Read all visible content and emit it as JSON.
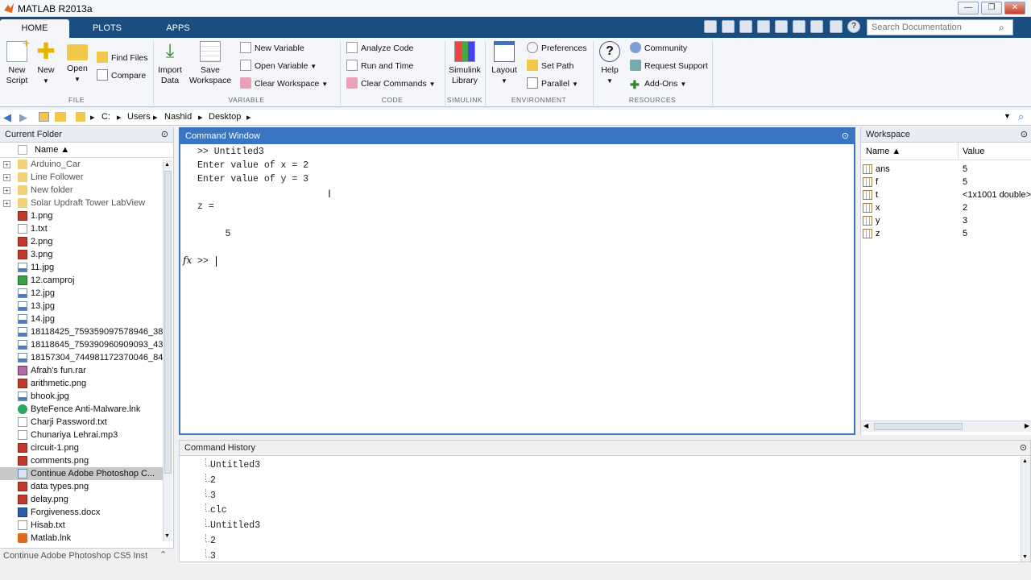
{
  "window": {
    "title": "MATLAB R2013a"
  },
  "tabs": [
    "HOME",
    "PLOTS",
    "APPS"
  ],
  "search": {
    "placeholder": "Search Documentation"
  },
  "ribbon": {
    "file": {
      "new_script": "New\nScript",
      "new": "New",
      "open": "Open",
      "find_files": "Find Files",
      "compare": "Compare",
      "label": "FILE"
    },
    "variable": {
      "import": "Import\nData",
      "save_ws": "Save\nWorkspace",
      "new_variable": "New Variable",
      "open_variable": "Open Variable",
      "clear_workspace": "Clear Workspace",
      "label": "VARIABLE"
    },
    "code": {
      "analyze": "Analyze Code",
      "run_time": "Run and Time",
      "clear_commands": "Clear Commands",
      "label": "CODE"
    },
    "simulink": {
      "library": "Simulink\nLibrary",
      "label": "SIMULINK"
    },
    "environment": {
      "layout": "Layout",
      "preferences": "Preferences",
      "set_path": "Set Path",
      "parallel": "Parallel",
      "label": "ENVIRONMENT"
    },
    "resources": {
      "help": "Help",
      "community": "Community",
      "request_support": "Request Support",
      "addons": "Add-Ons",
      "label": "RESOURCES"
    }
  },
  "address": [
    "C:",
    "Users",
    "Nashid",
    "Desktop"
  ],
  "current_folder": {
    "title": "Current Folder",
    "col_name": "Name ▲",
    "items": [
      {
        "name": "Arduino_Car",
        "type": "folder"
      },
      {
        "name": "Line Follower",
        "type": "folder"
      },
      {
        "name": "New folder",
        "type": "folder"
      },
      {
        "name": "Solar Updraft Tower LabView",
        "type": "folder"
      },
      {
        "name": "1.png",
        "type": "png"
      },
      {
        "name": "1.txt",
        "type": "txt"
      },
      {
        "name": "2.png",
        "type": "png"
      },
      {
        "name": "3.png",
        "type": "png"
      },
      {
        "name": "11.jpg",
        "type": "jpg"
      },
      {
        "name": "12.camproj",
        "type": "cam"
      },
      {
        "name": "12.jpg",
        "type": "jpg"
      },
      {
        "name": "13.jpg",
        "type": "jpg"
      },
      {
        "name": "14.jpg",
        "type": "jpg"
      },
      {
        "name": "18118425_759359097578946_38...",
        "type": "jpg"
      },
      {
        "name": "18118645_759390960909093_43...",
        "type": "jpg"
      },
      {
        "name": "18157304_744981172370046_84...",
        "type": "jpg"
      },
      {
        "name": "Afrah's fun.rar",
        "type": "rar"
      },
      {
        "name": "arithmetic.png",
        "type": "png"
      },
      {
        "name": "bhook.jpg",
        "type": "jpg"
      },
      {
        "name": "ByteFence Anti-Malware.lnk",
        "type": "shield"
      },
      {
        "name": "Charji Password.txt",
        "type": "txt"
      },
      {
        "name": "Chunariya Lehrai.mp3",
        "type": "txt"
      },
      {
        "name": "circuit-1.png",
        "type": "png"
      },
      {
        "name": "comments.png",
        "type": "png"
      },
      {
        "name": "Continue Adobe Photoshop C...",
        "type": "lnk"
      },
      {
        "name": "data types.png",
        "type": "png"
      },
      {
        "name": "delay.png",
        "type": "png"
      },
      {
        "name": "Forgiveness.docx",
        "type": "doc"
      },
      {
        "name": "Hisab.txt",
        "type": "txt"
      },
      {
        "name": "Matlab.lnk",
        "type": "matlab"
      }
    ],
    "status": "Continue Adobe Photoshop CS5 Inst"
  },
  "command_window": {
    "title": "Command Window",
    "lines": [
      ">> Untitled3",
      "Enter value of x = 2",
      "Enter value of y = 3",
      "",
      "z =",
      "",
      "     5",
      ""
    ],
    "prompt": ">>"
  },
  "workspace": {
    "title": "Workspace",
    "col_name": "Name ▲",
    "col_value": "Value",
    "vars": [
      {
        "name": "ans",
        "value": "5"
      },
      {
        "name": "f",
        "value": "5"
      },
      {
        "name": "t",
        "value": "<1x1001 double>"
      },
      {
        "name": "x",
        "value": "2"
      },
      {
        "name": "y",
        "value": "3"
      },
      {
        "name": "z",
        "value": "5"
      }
    ]
  },
  "history": {
    "title": "Command History",
    "items": [
      "Untitled3",
      "2",
      "3",
      "clc",
      "Untitled3",
      "2",
      "3"
    ]
  },
  "colors": {
    "tabbar": "#1a4d80",
    "accent": "#3a75c4"
  }
}
